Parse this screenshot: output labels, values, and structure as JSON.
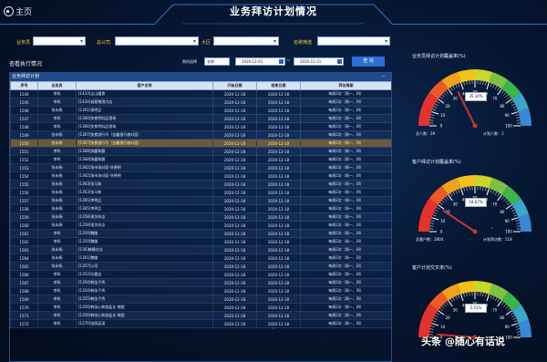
{
  "header": {
    "home_label": "主页",
    "title": "业务拜访计划情况"
  },
  "filters": {
    "salesperson_label": "业务员",
    "company_label": "总公司",
    "region_label": "大区",
    "name_filter_label": "名称筛选",
    "date_range_label": "期间选择",
    "period_value": "名称",
    "date_from": "2020-12-01",
    "date_to": "2020-12-31",
    "range_sep": "~",
    "query_button": "查 询"
  },
  "section_title": "查看执行情况",
  "table": {
    "band_title": "业务拜访计划",
    "more": "···",
    "columns": [
      "序号",
      "业务员",
      "客户名称",
      "开始日期",
      "结束日期",
      "拜访周期"
    ],
    "rows": [
      [
        "1544",
        "李科",
        "[1433]吉山屠食",
        "2020-12-18",
        "2020-12-18",
        "每周2次（周一、四）"
      ],
      [
        "1545",
        "李科",
        "[1434]诚意猪酒大店",
        "2020-12-18",
        "2020-12-18",
        "每周2次（周一、四）"
      ],
      [
        "1546",
        "张永杨",
        "[1361]香明品",
        "2020-12-18",
        "2020-12-18",
        "每周2次（周一、四）"
      ],
      [
        "1547",
        "李科",
        "[1366]快食明料品酒场",
        "2020-12-18",
        "2020-12-18",
        "每周2次（周一、四）"
      ],
      [
        "1548",
        "李科",
        "[1366]快食明料品酒场",
        "2020-12-18",
        "2020-12-18",
        "每周2次（周一、四）"
      ],
      [
        "1549",
        "张永杨",
        "[1367]快食酒行号（金鑫银行旗对面）",
        "2020-12-18",
        "2020-12-18",
        "每周2次（周一、四）"
      ],
      [
        "1550",
        "张永杨",
        "[1367]快食酒行号（金鑫银行旗对面）",
        "2020-12-18",
        "2020-12-18",
        "每周2次（周一、四）"
      ],
      [
        "1551",
        "李科",
        "[1368]快露和酸",
        "2020-12-18",
        "2020-12-18",
        "每周2次（周一、四）"
      ],
      [
        "1552",
        "李科",
        "[1368]快露和酸",
        "2020-12-18",
        "2020-12-18",
        "每周2次（周一、四）"
      ],
      [
        "1553",
        "张永杨",
        "[1362]场市场对面-徐德明",
        "2020-12-18",
        "2020-12-18",
        "每周2次（周一、四）"
      ],
      [
        "1554",
        "张永杨",
        "[1362]场市场对面-徐德明",
        "2020-12-18",
        "2020-12-18",
        "每周2次（周一、四）"
      ],
      [
        "1555",
        "张永杨",
        "[1363]张马和",
        "2020-12-18",
        "2020-12-18",
        "每周2次（周一、四）"
      ],
      [
        "1556",
        "张永杨",
        "[1363]张马和",
        "2020-12-18",
        "2020-12-18",
        "每周2次（周一、四）"
      ],
      [
        "1557",
        "张永杨",
        "[1365]李明品",
        "2020-12-18",
        "2020-12-18",
        "每周2次（周一、四）"
      ],
      [
        "1558",
        "张永杨",
        "[1365]李明品",
        "2020-12-18",
        "2020-12-18",
        "每周2次（周一、四）"
      ],
      [
        "1559",
        "张永杨",
        "[1358]现洗车店",
        "2020-12-18",
        "2020-12-18",
        "每周2次（周一、四）"
      ],
      [
        "1560",
        "张永杨",
        "[1358]现洗车店",
        "2020-12-18",
        "2020-12-18",
        "每周2次（周一、四）"
      ],
      [
        "1561",
        "李科",
        "[1359]魏腊",
        "2020-12-18",
        "2020-12-18",
        "每周2次（周一、四）"
      ],
      [
        "1562",
        "李科",
        "[1359]魏腊",
        "2020-12-18",
        "2020-12-18",
        "每周2次（周一、四）"
      ],
      [
        "1563",
        "张永杨",
        "[136]韩横交业",
        "2020-12-18",
        "2020-12-18",
        "每周2次（周一、四）"
      ],
      [
        "1564",
        "张永杨",
        "[1361]魏腊",
        "2020-12-18",
        "2020-12-18",
        "每周2次（周一、四）"
      ],
      [
        "1565",
        "张永杨",
        "[1357]公司",
        "2020-12-18",
        "2020-12-18",
        "每周2次（周一、四）"
      ],
      [
        "1566",
        "李科",
        "[1352]乐圆金",
        "2020-12-18",
        "2020-12-18",
        "每周2次（周一、四）"
      ],
      [
        "1567",
        "李科",
        "[1354]韩张子秀",
        "2020-12-18",
        "2020-12-18",
        "每周2次（周一、四）"
      ],
      [
        "1568",
        "李科",
        "[1354]韩张子秀",
        "2020-12-18",
        "2020-12-18",
        "每周2次（周一、四）"
      ],
      [
        "1569",
        "李科",
        "[1355]韩张子秀",
        "2020-12-18",
        "2020-12-18",
        "每周2次（周一、四）"
      ],
      [
        "1570",
        "李科",
        "[1356]韩张心和加盐长 晓超",
        "2020-12-18",
        "2020-12-18",
        "每周2次（周一、四）"
      ],
      [
        "1571",
        "李科",
        "[1356]韩张心和加盐长 晓超",
        "2020-12-18",
        "2020-12-18",
        "每周2次（周一、四）"
      ],
      [
        "1572",
        "李科",
        "[1276]张照英语",
        "2020-12-18",
        "2020-12-18",
        "每周2次（周一、四）"
      ]
    ],
    "highlight_index": 6
  },
  "gauges": [
    {
      "title": "业务员拜访计划覆盖率(%)",
      "value_label": "35.34%",
      "value": 35.34,
      "stats_left": "总人数：29",
      "stats_right": "计划人数：3"
    },
    {
      "title": "客户拜访计划覆盖率(%)",
      "value_label": "18.67%",
      "value": 18.67,
      "stats_left": "总客户数：2804",
      "stats_right": "计划拜访数：518"
    },
    {
      "title": "客户计划交叉率(%)",
      "value_label": "2.51%",
      "value": 2.51,
      "stats_left": "",
      "stats_right": ""
    }
  ],
  "gauge_ticks": [
    "0",
    "10",
    "20",
    "30",
    "40",
    "50",
    "60",
    "70",
    "80",
    "90",
    "100"
  ],
  "colors": {
    "accent": "#2a6fd6",
    "gauge_red": "#e5322d",
    "gauge_yellow": "#f0a21a",
    "gauge_green": "#3bb54a",
    "gauge_blue": "#3b86d9"
  },
  "watermark": "头条 @随心有话说"
}
